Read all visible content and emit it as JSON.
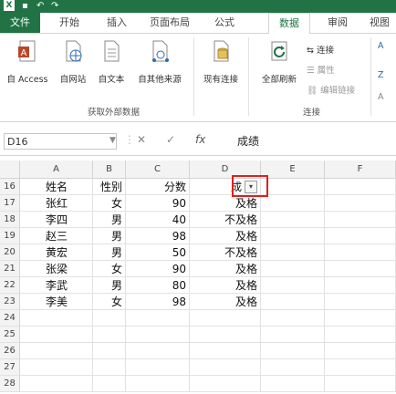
{
  "app": {
    "logo_text": "X"
  },
  "qat": {
    "undo_icon": "undo-icon",
    "redo_icon": "redo-icon"
  },
  "tabs": [
    {
      "label": "文件"
    },
    {
      "label": "开始"
    },
    {
      "label": "插入"
    },
    {
      "label": "页面布局"
    },
    {
      "label": "公式"
    },
    {
      "label": "数据"
    },
    {
      "label": "审阅"
    },
    {
      "label": "视图"
    }
  ],
  "ribbon": {
    "get_external": {
      "buttons": [
        {
          "label": "自 Access"
        },
        {
          "label": "自网站"
        },
        {
          "label": "自文本"
        },
        {
          "label": "自其他来源"
        },
        {
          "label": "现有连接"
        }
      ],
      "group_label": "获取外部数据"
    },
    "connections": {
      "refresh_label": "全部刷新",
      "connect_label": "连接",
      "properties_label": "属性",
      "edit_links_label": "编辑链接",
      "group_label": "连接"
    }
  },
  "formula_bar": {
    "name_box": "D16",
    "cancel": "✕",
    "enter": "✓",
    "fx": "fx",
    "value": "成绩"
  },
  "sheet": {
    "columns": [
      "A",
      "B",
      "C",
      "D",
      "E",
      "F"
    ],
    "rows": [
      {
        "num": "16",
        "a": "姓名",
        "b": "性别",
        "c": "分数",
        "d": "成"
      },
      {
        "num": "17",
        "a": "张红",
        "b": "女",
        "c": "90",
        "d": "及格"
      },
      {
        "num": "18",
        "a": "李四",
        "b": "男",
        "c": "40",
        "d": "不及格"
      },
      {
        "num": "19",
        "a": "赵三",
        "b": "男",
        "c": "98",
        "d": "及格"
      },
      {
        "num": "20",
        "a": "黄宏",
        "b": "男",
        "c": "50",
        "d": "不及格"
      },
      {
        "num": "21",
        "a": "张梁",
        "b": "女",
        "c": "90",
        "d": "及格"
      },
      {
        "num": "22",
        "a": "李武",
        "b": "男",
        "c": "80",
        "d": "及格"
      },
      {
        "num": "23",
        "a": "李美",
        "b": "女",
        "c": "98",
        "d": "及格"
      },
      {
        "num": "24",
        "a": "",
        "b": "",
        "c": "",
        "d": ""
      },
      {
        "num": "25",
        "a": "",
        "b": "",
        "c": "",
        "d": ""
      },
      {
        "num": "26",
        "a": "",
        "b": "",
        "c": "",
        "d": ""
      },
      {
        "num": "27",
        "a": "",
        "b": "",
        "c": "",
        "d": ""
      },
      {
        "num": "28",
        "a": "",
        "b": "",
        "c": "",
        "d": ""
      }
    ]
  },
  "colors": {
    "brand": "#217346",
    "highlight": "#e02020"
  }
}
